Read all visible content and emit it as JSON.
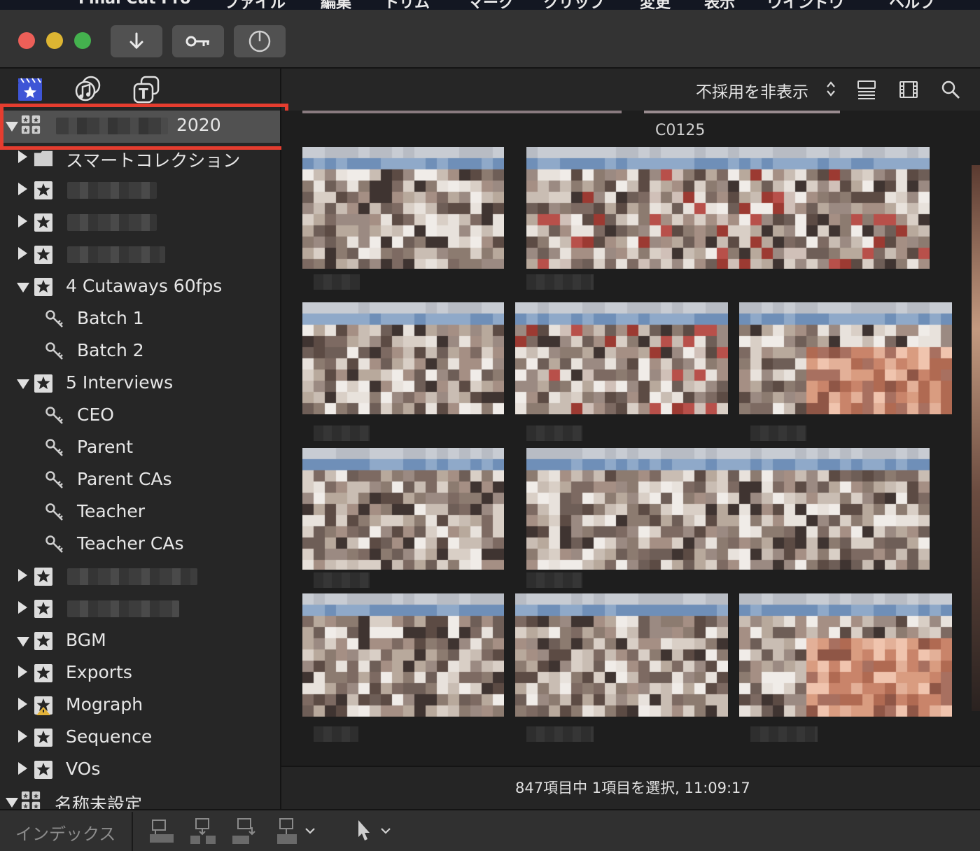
{
  "menubar": {
    "items": [
      "Final Cut Pro",
      "ファイル",
      "編集",
      "トリム",
      "マーク",
      "クリップ",
      "変更",
      "表示",
      "ウインドウ",
      "ヘルプ"
    ]
  },
  "toolbar": {
    "import_icon": "download-arrow-icon",
    "keyword_icon": "key-icon",
    "background_tasks_icon": "progress-circle-icon"
  },
  "sidebar_tabs": [
    "libraries-icon",
    "photos-audio-icon",
    "titles-generators-icon"
  ],
  "browser_header": {
    "filter_label": "不採用を非表示",
    "icons": [
      "list-view-icon",
      "clip-appearance-icon",
      "search-icon"
    ]
  },
  "sidebar": {
    "library_name": "2020",
    "items": [
      {
        "label": "スマートコレクション",
        "type": "folder",
        "state": "closed"
      },
      {
        "label": "",
        "type": "event",
        "state": "closed"
      },
      {
        "label": "",
        "type": "event",
        "state": "closed"
      },
      {
        "label": "",
        "type": "event",
        "state": "closed"
      },
      {
        "label": "4 Cutaways 60fps",
        "type": "event",
        "state": "open"
      },
      {
        "label": "Batch 1",
        "type": "keyword"
      },
      {
        "label": "Batch 2",
        "type": "keyword"
      },
      {
        "label": "5 Interviews",
        "type": "event",
        "state": "open"
      },
      {
        "label": "CEO",
        "type": "keyword"
      },
      {
        "label": "Parent",
        "type": "keyword"
      },
      {
        "label": "Parent CAs",
        "type": "keyword"
      },
      {
        "label": "Teacher",
        "type": "keyword"
      },
      {
        "label": "Teacher CAs",
        "type": "keyword"
      },
      {
        "label": "",
        "type": "event",
        "state": "closed"
      },
      {
        "label": "",
        "type": "event",
        "state": "closed"
      },
      {
        "label": "BGM",
        "type": "event",
        "state": "open"
      },
      {
        "label": "Exports",
        "type": "event",
        "state": "closed"
      },
      {
        "label": "Mograph",
        "type": "event",
        "state": "closed",
        "warning": true
      },
      {
        "label": "Sequence",
        "type": "event",
        "state": "closed"
      },
      {
        "label": "VOs",
        "type": "event",
        "state": "closed"
      },
      {
        "label": "名称未設定",
        "type": "library",
        "state": "open"
      }
    ]
  },
  "browser": {
    "clip_name": "C0125",
    "status": "847項目中 1項目を選択, 11:09:17"
  },
  "bottombar": {
    "index_label": "インデックス",
    "icons": [
      "connect-clip-icon",
      "insert-clip-icon",
      "append-clip-icon",
      "overwrite-clip-icon",
      "select-tool-icon"
    ]
  }
}
